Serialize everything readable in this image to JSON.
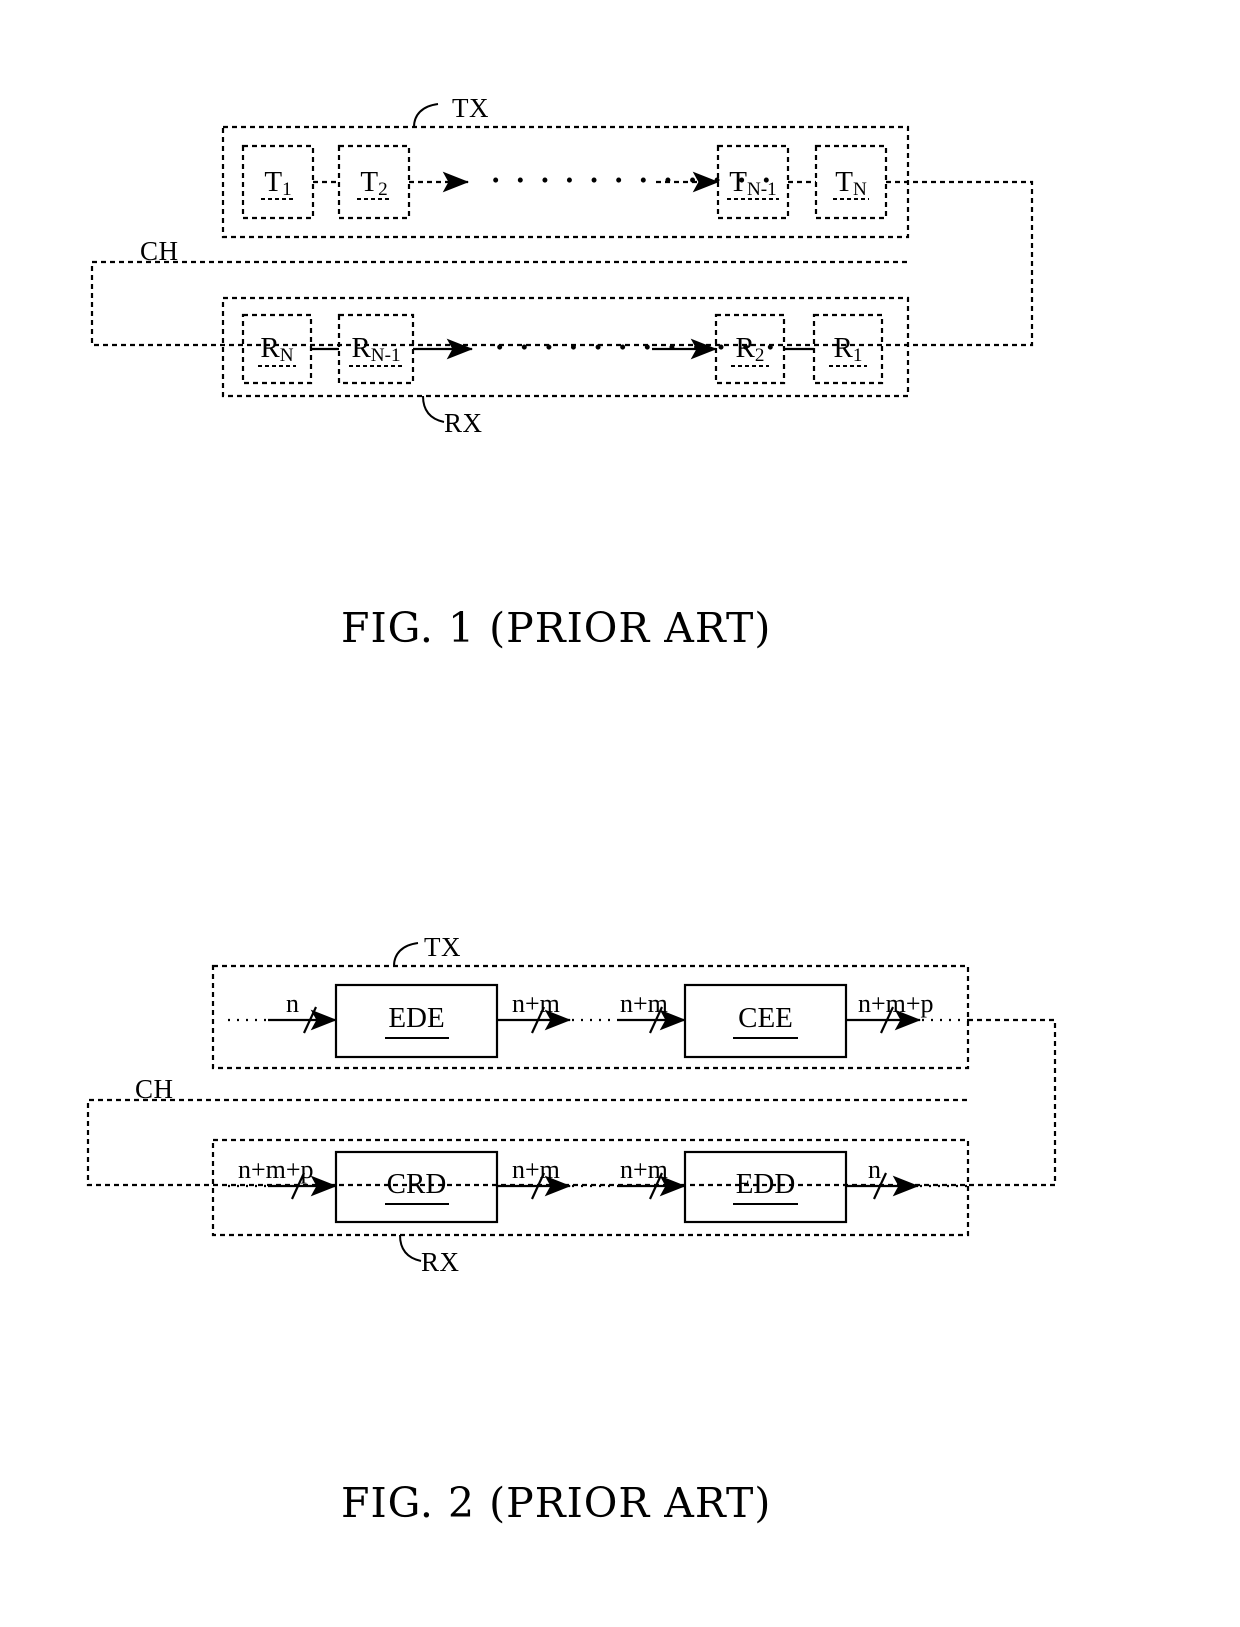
{
  "document": {
    "type": "patent-figure-sheet",
    "background": "#ffffff",
    "ink": "#000000"
  },
  "figures": [
    {
      "id": "fig1",
      "caption": "FIG. 1 (PRIOR ART)",
      "channel_label": "CH",
      "rows": [
        {
          "id": "tx",
          "label": "TX",
          "blocks": [
            {
              "id": "t1",
              "base": "T",
              "sub": "1"
            },
            {
              "id": "t2",
              "base": "T",
              "sub": "2"
            },
            {
              "id": "tn1",
              "base": "T",
              "sub": "N-1"
            },
            {
              "id": "tn",
              "base": "T",
              "sub": "N"
            }
          ],
          "ellipsis": "• • • • • • • • • • • •"
        },
        {
          "id": "rx",
          "label": "RX",
          "blocks": [
            {
              "id": "rn",
              "base": "R",
              "sub": "N"
            },
            {
              "id": "rn1",
              "base": "R",
              "sub": "N-1"
            },
            {
              "id": "r2",
              "base": "R",
              "sub": "2"
            },
            {
              "id": "r1",
              "base": "R",
              "sub": "1"
            }
          ],
          "ellipsis": "• • • • • • • • • • • •"
        }
      ]
    },
    {
      "id": "fig2",
      "caption": "FIG. 2 (PRIOR ART)",
      "channel_label": "CH",
      "rows": [
        {
          "id": "tx",
          "label": "TX",
          "blocks": [
            {
              "id": "ede",
              "text": "EDE"
            },
            {
              "id": "cee",
              "text": "CEE"
            }
          ],
          "bus_labels": [
            "n",
            "n+m",
            "n+m",
            "n+m+p"
          ]
        },
        {
          "id": "rx",
          "label": "RX",
          "blocks": [
            {
              "id": "crd",
              "text": "CRD"
            },
            {
              "id": "edd",
              "text": "EDD"
            }
          ],
          "bus_labels": [
            "n+m+p",
            "n+m",
            "n+m",
            "n"
          ]
        }
      ]
    }
  ]
}
